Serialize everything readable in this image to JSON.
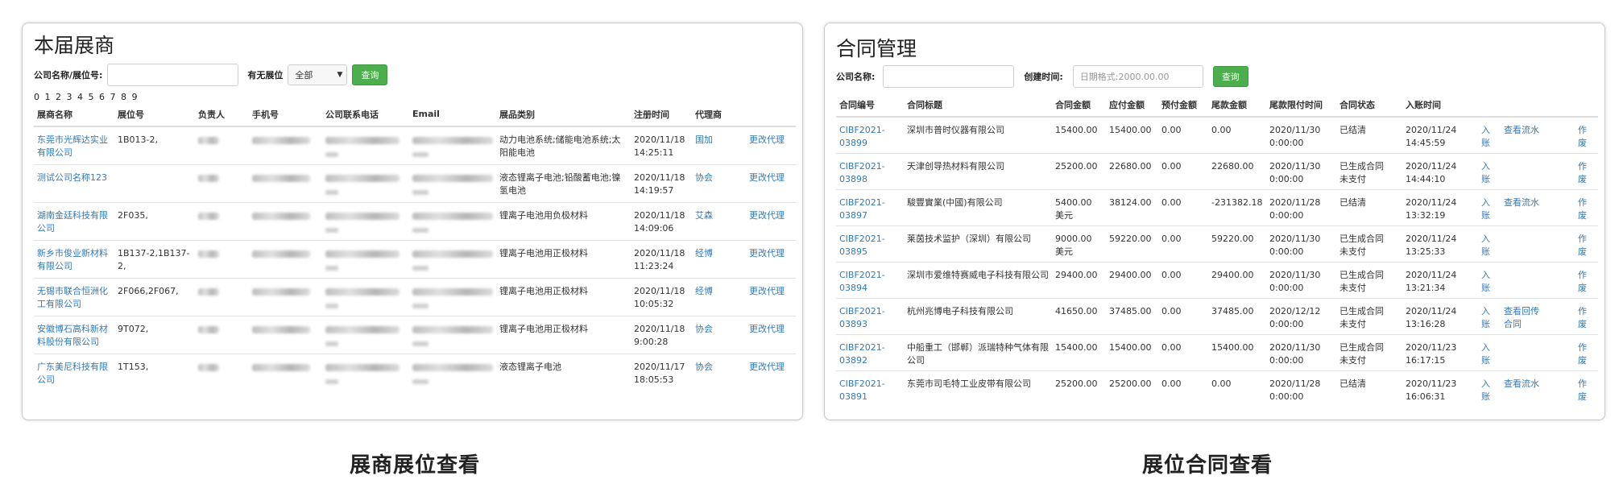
{
  "exhibitors": {
    "title": "本届展商",
    "filter": {
      "company_label": "公司名称/展位号:",
      "company_value": "",
      "booth_label": "有无展位",
      "booth_selected": "全部",
      "query_label": "查询"
    },
    "pager": "0 1 2 3 4 5 6 7 8 9",
    "columns": [
      "展商名称",
      "展位号",
      "负责人",
      "手机号",
      "公司联系电话",
      "Email",
      "展品类别",
      "注册时间",
      "代理商",
      ""
    ],
    "rows": [
      {
        "name": "东莞市光辉达实业有限公司",
        "booth": "1B013-2,",
        "category": "动力电池系统;储能电池系统;太阳能电池",
        "reg_date": "2020/11/18",
        "reg_time": "14:25:11",
        "agent": "国加",
        "action": "更改代理"
      },
      {
        "name": "测试公司名称123",
        "booth": "",
        "category": "液态锂离子电池;铅酸蓄电池;镍氢电池",
        "reg_date": "2020/11/18",
        "reg_time": "14:19:57",
        "agent": "协会",
        "action": "更改代理"
      },
      {
        "name": "湖南金廷科技有限公司",
        "booth": "2F035,",
        "category": "锂离子电池用负极材料",
        "reg_date": "2020/11/18",
        "reg_time": "14:09:06",
        "agent": "艾森",
        "action": "更改代理"
      },
      {
        "name": "新乡市俊业新材料有限公司",
        "booth": "1B137-2,1B137-2,",
        "category": "锂离子电池用正极材料",
        "reg_date": "2020/11/18",
        "reg_time": "11:23:24",
        "agent": "经博",
        "action": "更改代理"
      },
      {
        "name": "无锡市联合恒洲化工有限公司",
        "booth": "2F066,2F067,",
        "category": "锂离子电池用正极材料",
        "reg_date": "2020/11/18",
        "reg_time": "10:05:32",
        "agent": "经博",
        "action": "更改代理"
      },
      {
        "name": "安徽博石高科新材料股份有限公司",
        "booth": "9T072,",
        "category": "锂离子电池用正极材料",
        "reg_date": "2020/11/18",
        "reg_time": "9:00:28",
        "agent": "协会",
        "action": "更改代理"
      },
      {
        "name": "广东美尼科技有限公司",
        "booth": "1T153,",
        "category": "液态锂离子电池",
        "reg_date": "2020/11/17",
        "reg_time": "18:05:53",
        "agent": "协会",
        "action": "更改代理"
      }
    ]
  },
  "contracts": {
    "title": "合同管理",
    "filter": {
      "company_label": "公司名称:",
      "company_value": "",
      "created_label": "创建时间:",
      "created_placeholder": "日期格式:2000.00.00",
      "query_label": "查询"
    },
    "columns": [
      "合同编号",
      "合同标题",
      "合同金额",
      "应付金额",
      "预付金额",
      "尾款金额",
      "尾款限付时间",
      "合同状态",
      "入账时间",
      "",
      "",
      ""
    ],
    "rows": [
      {
        "id_a": "CIBF2021-",
        "id_b": "03899",
        "title": "深圳市普时仪器有限公司",
        "amount_a": "15400.00",
        "amount_b": "",
        "payable": "15400.00",
        "prepaid": "0.00",
        "balance": "0.00",
        "due_a": "2020/11/30",
        "due_b": "0:00:00",
        "status_a": "已结清",
        "status_b": "",
        "posted_a": "2020/11/24",
        "posted_b": "14:45:59",
        "act1_a": "入",
        "act1_b": "账",
        "act2_a": "查看流水",
        "act2_b": "",
        "act3_a": "作",
        "act3_b": "废"
      },
      {
        "id_a": "CIBF2021-",
        "id_b": "03898",
        "title": "天津创导热材料有限公司",
        "amount_a": "25200.00",
        "amount_b": "",
        "payable": "22680.00",
        "prepaid": "0.00",
        "balance": "22680.00",
        "due_a": "2020/11/30",
        "due_b": "0:00:00",
        "status_a": "已生成合同",
        "status_b": "未支付",
        "posted_a": "2020/11/24",
        "posted_b": "14:44:10",
        "act1_a": "入",
        "act1_b": "账",
        "act2_a": "",
        "act2_b": "",
        "act3_a": "作",
        "act3_b": "废"
      },
      {
        "id_a": "CIBF2021-",
        "id_b": "03897",
        "title": "駿豐實業(中國)有限公司",
        "amount_a": "5400.00",
        "amount_b": "美元",
        "payable": "38124.00",
        "prepaid": "0.00",
        "balance": "-231382.18",
        "due_a": "2020/11/28",
        "due_b": "0:00:00",
        "status_a": "已结清",
        "status_b": "",
        "posted_a": "2020/11/24",
        "posted_b": "13:32:19",
        "act1_a": "入",
        "act1_b": "账",
        "act2_a": "查看流水",
        "act2_b": "",
        "act3_a": "作",
        "act3_b": "废"
      },
      {
        "id_a": "CIBF2021-",
        "id_b": "03895",
        "title": "莱茵技术监护（深圳）有限公司",
        "amount_a": "9000.00",
        "amount_b": "美元",
        "payable": "59220.00",
        "prepaid": "0.00",
        "balance": "59220.00",
        "due_a": "2020/11/30",
        "due_b": "0:00:00",
        "status_a": "已生成合同",
        "status_b": "未支付",
        "posted_a": "2020/11/24",
        "posted_b": "13:25:33",
        "act1_a": "入",
        "act1_b": "账",
        "act2_a": "",
        "act2_b": "",
        "act3_a": "作",
        "act3_b": "废"
      },
      {
        "id_a": "CIBF2021-",
        "id_b": "03894",
        "title": "深圳市爱维特赛威电子科技有限公司",
        "amount_a": "29400.00",
        "amount_b": "",
        "payable": "29400.00",
        "prepaid": "0.00",
        "balance": "29400.00",
        "due_a": "2020/11/30",
        "due_b": "0:00:00",
        "status_a": "已生成合同",
        "status_b": "未支付",
        "posted_a": "2020/11/24",
        "posted_b": "13:21:34",
        "act1_a": "入",
        "act1_b": "账",
        "act2_a": "",
        "act2_b": "",
        "act3_a": "作",
        "act3_b": "废"
      },
      {
        "id_a": "CIBF2021-",
        "id_b": "03893",
        "title": "杭州兆博电子科技有限公司",
        "amount_a": "41650.00",
        "amount_b": "",
        "payable": "37485.00",
        "prepaid": "0.00",
        "balance": "37485.00",
        "due_a": "2020/12/12",
        "due_b": "0:00:00",
        "status_a": "已生成合同",
        "status_b": "未支付",
        "posted_a": "2020/11/24",
        "posted_b": "13:16:28",
        "act1_a": "入",
        "act1_b": "账",
        "act2_a": "查看回传",
        "act2_b": "合同",
        "act3_a": "作",
        "act3_b": "废"
      },
      {
        "id_a": "CIBF2021-",
        "id_b": "03892",
        "title": "中船重工（邯郸）派瑞特种气体有限公司",
        "amount_a": "15400.00",
        "amount_b": "",
        "payable": "15400.00",
        "prepaid": "0.00",
        "balance": "15400.00",
        "due_a": "2020/11/30",
        "due_b": "0:00:00",
        "status_a": "已生成合同",
        "status_b": "未支付",
        "posted_a": "2020/11/23",
        "posted_b": "16:17:15",
        "act1_a": "入",
        "act1_b": "账",
        "act2_a": "",
        "act2_b": "",
        "act3_a": "作",
        "act3_b": "废"
      },
      {
        "id_a": "CIBF2021-",
        "id_b": "03891",
        "title": "东莞市司毛特工业皮带有限公司",
        "amount_a": "25200.00",
        "amount_b": "",
        "payable": "25200.00",
        "prepaid": "0.00",
        "balance": "0.00",
        "due_a": "2020/11/28",
        "due_b": "0:00:00",
        "status_a": "已结清",
        "status_b": "",
        "posted_a": "2020/11/23",
        "posted_b": "16:06:31",
        "act1_a": "入",
        "act1_b": "账",
        "act2_a": "查看流水",
        "act2_b": "",
        "act3_a": "作",
        "act3_b": "废"
      }
    ]
  },
  "captions": {
    "left": "展商展位查看",
    "right": "展位合同查看"
  }
}
